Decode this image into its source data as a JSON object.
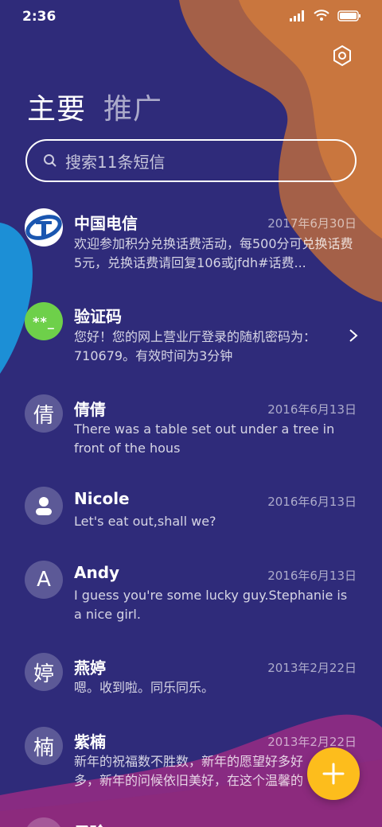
{
  "status_bar": {
    "time": "2:36"
  },
  "tabs": [
    {
      "label": "主要",
      "active": true
    },
    {
      "label": "推广",
      "active": false
    }
  ],
  "search": {
    "placeholder": "搜索11条短信"
  },
  "conversations": [
    {
      "name": "中国电信",
      "date": "2017年6月30日",
      "preview": "欢迎参加积分兑换话费活动，每500分可兑换话费5元，兑换话费请回复106或jfdh#话费...",
      "avatar_icon": "china-telecom-logo"
    },
    {
      "name": "验证码",
      "date": "",
      "preview": "您好！您的网上营业厅登录的随机密码为：710679。有效时间为3分钟",
      "avatar_text": "**_"
    },
    {
      "name": "倩倩",
      "date": "2016年6月13日",
      "preview": "There was a table set out under a tree in front of the hous",
      "avatar_text": "倩"
    },
    {
      "name": "Nicole",
      "date": "2016年6月13日",
      "preview": "Let's eat out,shall we?",
      "avatar_icon": "person-icon"
    },
    {
      "name": "Andy",
      "date": "2016年6月13日",
      "preview": "I guess you're some lucky guy.Stephanie is a nice girl.",
      "avatar_text": "A"
    },
    {
      "name": "燕婷",
      "date": "2013年2月22日",
      "preview": "嗯。收到啦。同乐同乐。",
      "avatar_text": "婷"
    },
    {
      "name": "紫楠",
      "date": "2013年2月22日",
      "preview": "新年的祝福数不胜数，新年的愿望好多好多，新年的问候依旧美好，在这个温馨的时刻",
      "avatar_text": "楠"
    },
    {
      "name": "子琀",
      "date": "",
      "preview": "",
      "avatar_text": ""
    }
  ],
  "colors": {
    "background": "#2f2b7a",
    "orange_blob": "#c8733a",
    "blue_blob": "#1c8fd6",
    "pink_blob": "#a72c86",
    "fab": "#fdbd1c",
    "code_avatar": "#6ed04a"
  },
  "icons": {
    "settings": "gear-icon",
    "search": "search-icon",
    "fab": "plus-icon",
    "chevron": "chevron-right-icon"
  }
}
